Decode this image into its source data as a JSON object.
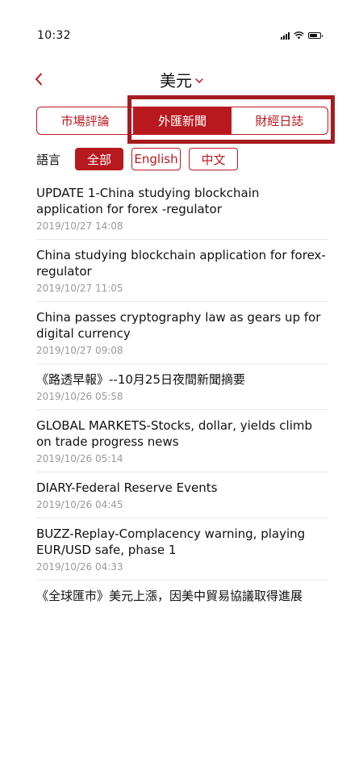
{
  "status_bar": {
    "time": "10:32"
  },
  "nav": {
    "title": "美元"
  },
  "tabs": [
    {
      "label": "市場評論"
    },
    {
      "label": "外匯新聞"
    },
    {
      "label": "財經日誌"
    }
  ],
  "language": {
    "label": "語言",
    "options": [
      {
        "label": "全部"
      },
      {
        "label": "English"
      },
      {
        "label": "中文"
      }
    ]
  },
  "news": [
    {
      "title": "UPDATE 1-China studying blockchain application for forex -regulator",
      "time": "2019/10/27 14:08"
    },
    {
      "title": "China studying blockchain application for forex-regulator",
      "time": "2019/10/27 11:05"
    },
    {
      "title": "China passes cryptography law as gears up for digital currency",
      "time": "2019/10/27 09:08"
    },
    {
      "title": "《路透早報》--10月25日夜間新聞摘要",
      "time": "2019/10/26 05:58"
    },
    {
      "title": "GLOBAL MARKETS-Stocks, dollar, yields climb on trade progress news",
      "time": "2019/10/26 05:14"
    },
    {
      "title": "DIARY-Federal Reserve Events",
      "time": "2019/10/26 04:45"
    },
    {
      "title": "BUZZ-Replay-Complacency warning, playing EUR/USD safe, phase 1",
      "time": "2019/10/26 04:33"
    },
    {
      "title": "《全球匯市》美元上漲，因美中貿易協議取得進展",
      "time": ""
    }
  ],
  "colors": {
    "accent": "#b8191e",
    "highlight": "#a51c20"
  }
}
